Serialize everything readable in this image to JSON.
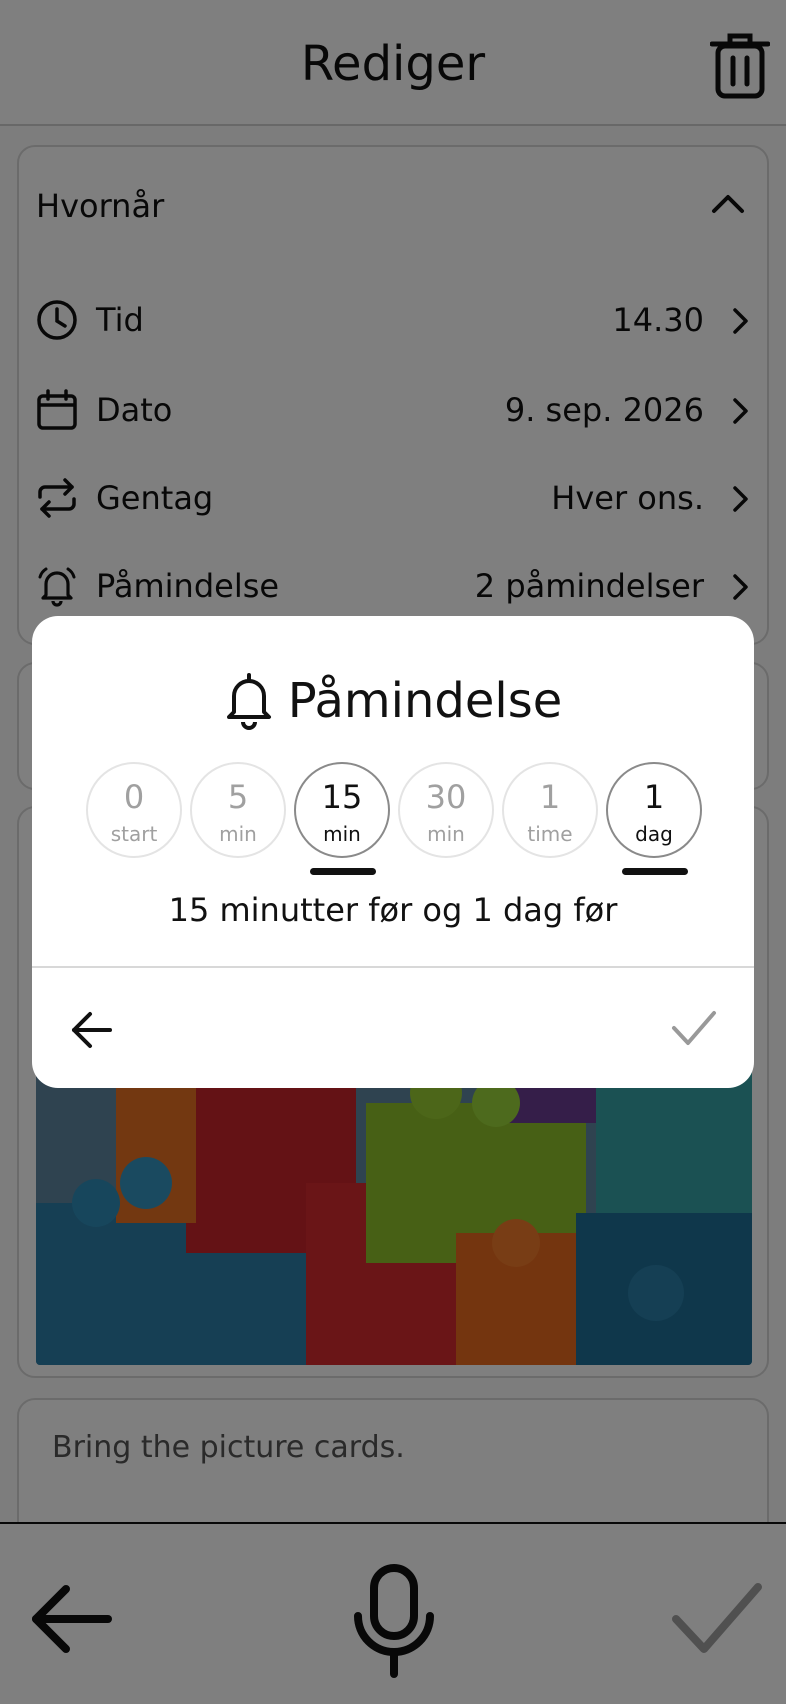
{
  "header": {
    "title": "Rediger"
  },
  "when": {
    "title": "Hvornår",
    "rows": [
      {
        "label": "Tid",
        "value": "14.30"
      },
      {
        "label": "Dato",
        "value": "9. sep. 2026"
      },
      {
        "label": "Gentag",
        "value": "Hver ons."
      },
      {
        "label": "Påmindelse",
        "value": "2 påmindelser"
      }
    ]
  },
  "note": {
    "text": "Bring the picture cards."
  },
  "dialog": {
    "title": "Påmindelse",
    "options": [
      {
        "number": "0",
        "unit": "start",
        "selected": false
      },
      {
        "number": "5",
        "unit": "min",
        "selected": false
      },
      {
        "number": "15",
        "unit": "min",
        "selected": true
      },
      {
        "number": "30",
        "unit": "min",
        "selected": false
      },
      {
        "number": "1",
        "unit": "time",
        "selected": false
      },
      {
        "number": "1",
        "unit": "dag",
        "selected": true
      }
    ],
    "summary": "15 minutter før og 1 dag før"
  },
  "icons": {
    "trash": "trash-icon",
    "chevron_up": "chevron-up-icon",
    "clock": "clock-icon",
    "calendar": "calendar-icon",
    "repeat": "repeat-icon",
    "alarm": "alarm-bell-icon",
    "bell": "bell-icon",
    "mic": "microphone-icon"
  },
  "colors": {
    "overlay": "#000000",
    "selected_border": "#8a8a8a",
    "muted_text": "#a0a0a0"
  }
}
